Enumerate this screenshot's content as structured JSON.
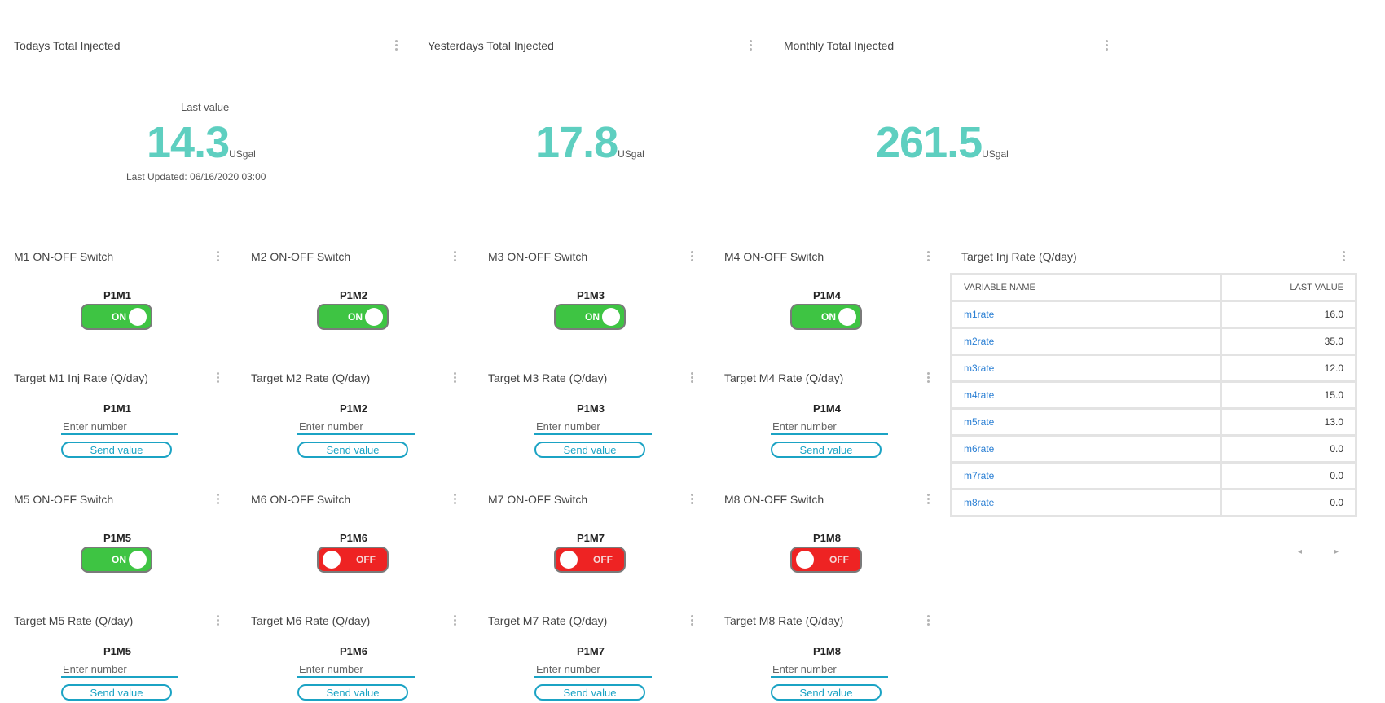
{
  "widgets_top": [
    {
      "title": "Todays Total Injected",
      "label": "Last value",
      "value": "14.3",
      "unit": "USgal",
      "updated": "Last Updated: 06/16/2020 03:00"
    },
    {
      "title": "Yesterdays Total Injected",
      "value": "17.8",
      "unit": "USgal"
    },
    {
      "title": "Monthly Total Injected",
      "value": "261.5",
      "unit": "USgal"
    }
  ],
  "switches": [
    {
      "title": "M1 ON-OFF Switch",
      "label": "P1M1",
      "state": "ON"
    },
    {
      "title": "M2 ON-OFF Switch",
      "label": "P1M2",
      "state": "ON"
    },
    {
      "title": "M3 ON-OFF Switch",
      "label": "P1M3",
      "state": "ON"
    },
    {
      "title": "M4 ON-OFF Switch",
      "label": "P1M4",
      "state": "ON"
    },
    {
      "title": "M5 ON-OFF Switch",
      "label": "P1M5",
      "state": "ON"
    },
    {
      "title": "M6 ON-OFF Switch",
      "label": "P1M6",
      "state": "OFF"
    },
    {
      "title": "M7 ON-OFF Switch",
      "label": "P1M7",
      "state": "OFF"
    },
    {
      "title": "M8 ON-OFF Switch",
      "label": "P1M8",
      "state": "OFF"
    }
  ],
  "rate_inputs": [
    {
      "title": "Target M1 Inj Rate (Q/day)",
      "label": "P1M1",
      "placeholder": "Enter number",
      "button": "Send value"
    },
    {
      "title": "Target M2 Rate (Q/day)",
      "label": "P1M2",
      "placeholder": "Enter number",
      "button": "Send value"
    },
    {
      "title": "Target M3 Rate (Q/day)",
      "label": "P1M3",
      "placeholder": "Enter number",
      "button": "Send value"
    },
    {
      "title": "Target M4 Rate (Q/day)",
      "label": "P1M4",
      "placeholder": "Enter number",
      "button": "Send value"
    },
    {
      "title": "Target M5 Rate (Q/day)",
      "label": "P1M5",
      "placeholder": "Enter number",
      "button": "Send value"
    },
    {
      "title": "Target M6 Rate (Q/day)",
      "label": "P1M6",
      "placeholder": "Enter number",
      "button": "Send value"
    },
    {
      "title": "Target M7 Rate (Q/day)",
      "label": "P1M7",
      "placeholder": "Enter number",
      "button": "Send value"
    },
    {
      "title": "Target M8 Rate (Q/day)",
      "label": "P1M8",
      "placeholder": "Enter number",
      "button": "Send value"
    }
  ],
  "table_widget": {
    "title": "Target Inj Rate (Q/day)",
    "headers": [
      "VARIABLE NAME",
      "LAST VALUE"
    ],
    "rows": [
      {
        "name": "m1rate",
        "value": "16.0"
      },
      {
        "name": "m2rate",
        "value": "35.0"
      },
      {
        "name": "m3rate",
        "value": "12.0"
      },
      {
        "name": "m4rate",
        "value": "15.0"
      },
      {
        "name": "m5rate",
        "value": "13.0"
      },
      {
        "name": "m6rate",
        "value": "0.0"
      },
      {
        "name": "m7rate",
        "value": "0.0"
      },
      {
        "name": "m8rate",
        "value": "0.0"
      }
    ],
    "prev_icon": "◂",
    "next_icon": "▸"
  },
  "colors": {
    "accent": "#5ecfc0",
    "on": "#3ec443",
    "off": "#ee2323",
    "input": "#1ba3c4",
    "link": "#2a7fd4"
  }
}
